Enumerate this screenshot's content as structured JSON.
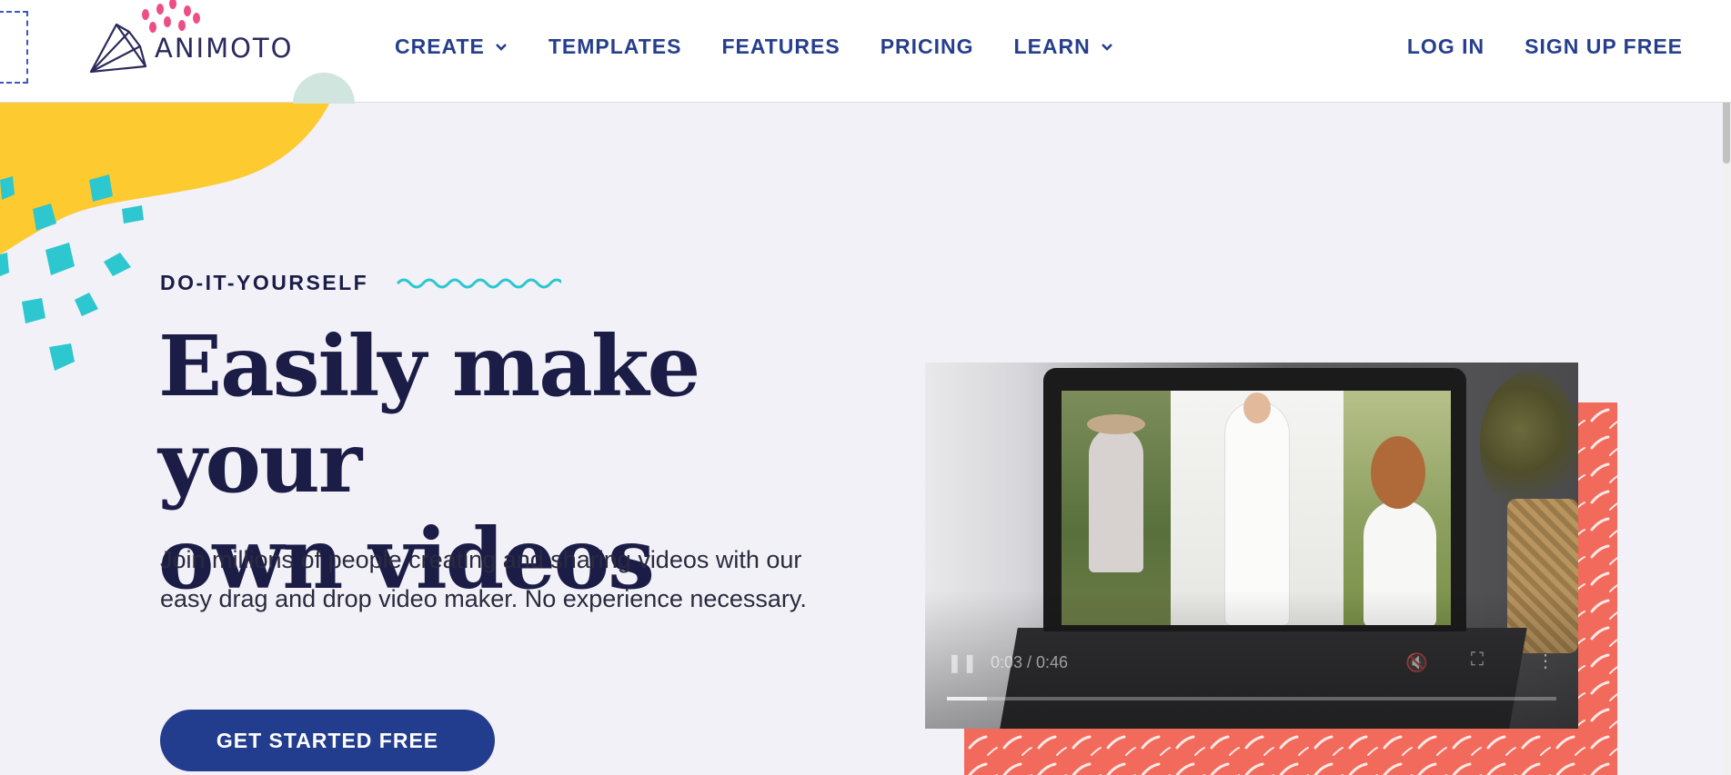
{
  "header": {
    "logo_text": "ANIMOTO",
    "nav": [
      {
        "label": "CREATE",
        "has_dropdown": true
      },
      {
        "label": "TEMPLATES",
        "has_dropdown": false
      },
      {
        "label": "FEATURES",
        "has_dropdown": false
      },
      {
        "label": "PRICING",
        "has_dropdown": false
      },
      {
        "label": "LEARN",
        "has_dropdown": true
      }
    ],
    "login_label": "LOG IN",
    "signup_label": "SIGN UP FREE"
  },
  "hero": {
    "eyebrow": "DO-IT-YOURSELF",
    "headline_line1": "Easily make your",
    "headline_line2": "own videos",
    "subtext": "Join millions of people creating and sharing videos with our easy drag and drop video maker. No experience necessary.",
    "cta_label": "GET STARTED FREE"
  },
  "video": {
    "time_display": "0:03 / 0:46",
    "progress_fraction": 0.065,
    "icons": [
      "pause-icon",
      "mute-icon",
      "fullscreen-icon",
      "more-icon"
    ]
  },
  "colors": {
    "brand_navy": "#233d8e",
    "headline": "#1b1d47",
    "accent_yellow": "#fdca30",
    "accent_teal": "#2cc7cf",
    "accent_coral": "#f26a5b",
    "accent_pink": "#ee4d87",
    "page_bg": "#f2f1f7"
  }
}
